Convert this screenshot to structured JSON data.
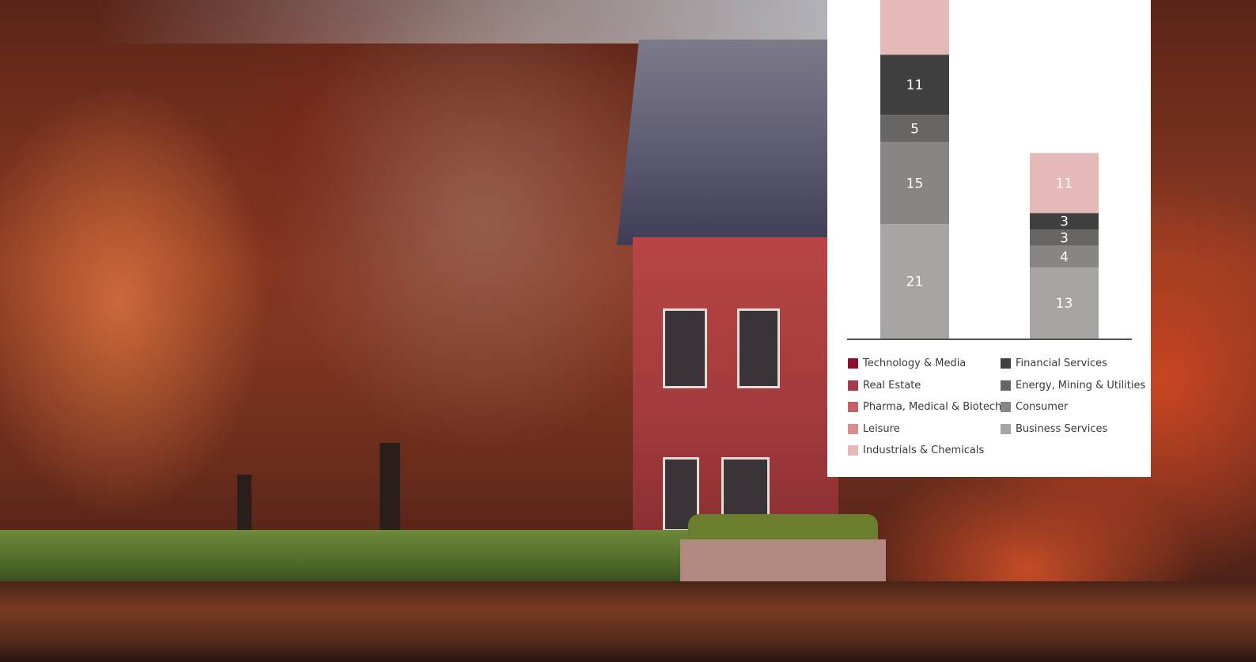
{
  "chart_data": {
    "type": "bar",
    "stacked": true,
    "categories": [
      "",
      ""
    ],
    "series": [
      {
        "name": "Business Services",
        "color": "#a8a4a3",
        "values": [
          21,
          13
        ]
      },
      {
        "name": "Consumer",
        "color": "#888584",
        "values": [
          15,
          4
        ]
      },
      {
        "name": "Energy, Mining & Utilities",
        "color": "#686665",
        "values": [
          5,
          3
        ]
      },
      {
        "name": "Financial Services",
        "color": "#404040",
        "values": [
          11,
          3
        ]
      },
      {
        "name": "Industrials & Chemicals",
        "color": "#e4b9b8",
        "values": [
          null,
          11
        ]
      },
      {
        "name": "Leisure",
        "color": "#d98f8f",
        "values": [
          null,
          null
        ]
      },
      {
        "name": "Pharma, Medical & Biotech",
        "color": "#c46268",
        "values": [
          null,
          null
        ]
      },
      {
        "name": "Real Estate",
        "color": "#a8384a",
        "values": [
          null,
          null
        ]
      },
      {
        "name": "Technology & Media",
        "color": "#8b0f32",
        "values": [
          null,
          null
        ]
      }
    ],
    "top_segment_left": {
      "name": "Industrials & Chemicals",
      "value": null
    },
    "legend": {
      "placement": "bottom",
      "left": [
        "Technology & Media",
        "Real Estate",
        "Pharma, Medical & Biotech",
        "Leisure",
        "Industrials & Chemicals"
      ],
      "right": [
        "Financial Services",
        "Energy, Mining & Utilities",
        "Consumer",
        "Business Services"
      ]
    },
    "grid": false
  },
  "colors": {
    "Technology & Media": "#8b0f32",
    "Real Estate": "#a8384a",
    "Pharma, Medical & Biotech": "#c46268",
    "Leisure": "#d98f8f",
    "Industrials & Chemicals": "#e4b9b8",
    "Financial Services": "#404040",
    "Energy, Mining & Utilities": "#686665",
    "Consumer": "#888584",
    "Business Services": "#a8a4a3",
    "baseline": "#505050"
  }
}
